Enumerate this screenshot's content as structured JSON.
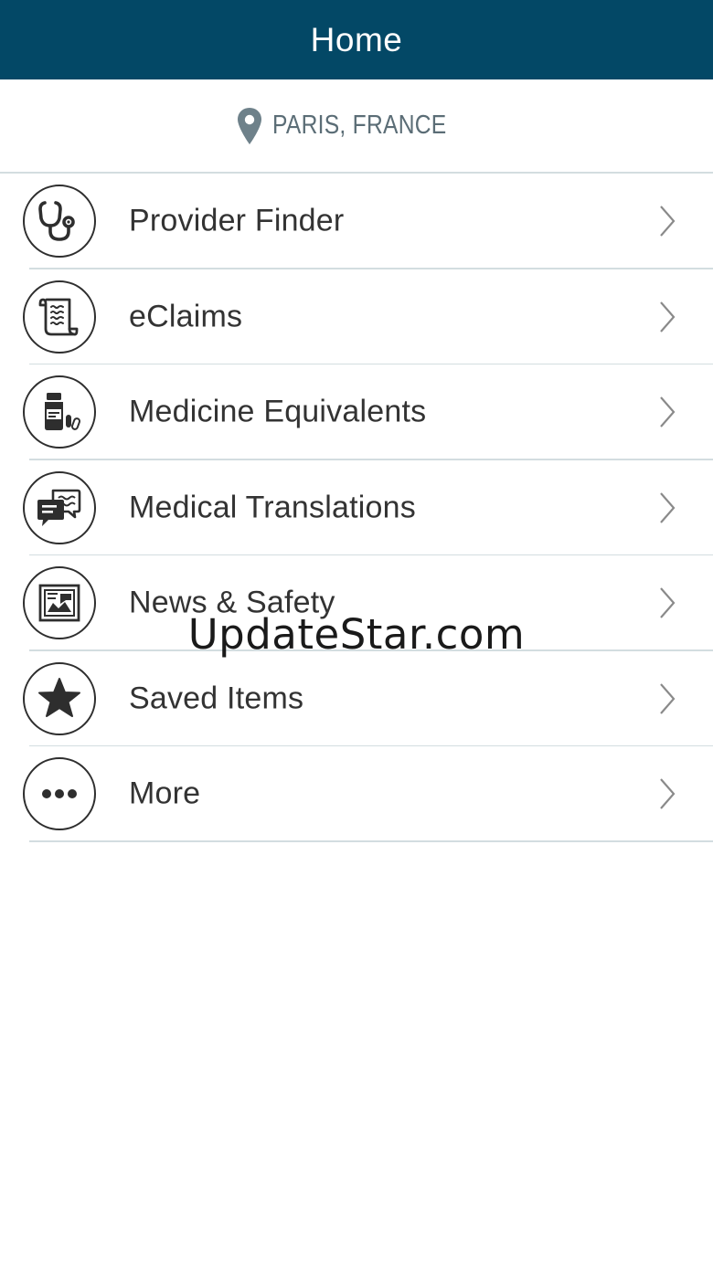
{
  "header": {
    "title": "Home"
  },
  "location": {
    "icon": "map-pin-icon",
    "label": "PARIS, FRANCE"
  },
  "menu": {
    "items": [
      {
        "label": "Provider Finder",
        "icon": "stethoscope-icon"
      },
      {
        "label": "eClaims",
        "icon": "scroll-document-icon"
      },
      {
        "label": "Medicine Equivalents",
        "icon": "medicine-bottle-icon"
      },
      {
        "label": "Medical Translations",
        "icon": "speech-bubbles-icon"
      },
      {
        "label": "News & Safety",
        "icon": "newspaper-icon"
      },
      {
        "label": "Saved Items",
        "icon": "star-icon"
      },
      {
        "label": "More",
        "icon": "more-dots-icon"
      }
    ]
  },
  "watermark": {
    "text": "UpdateStar.com"
  },
  "colors": {
    "header_bg": "#034866",
    "pin": "#6e818a",
    "text": "#333333",
    "divider": "#d3dde0"
  }
}
